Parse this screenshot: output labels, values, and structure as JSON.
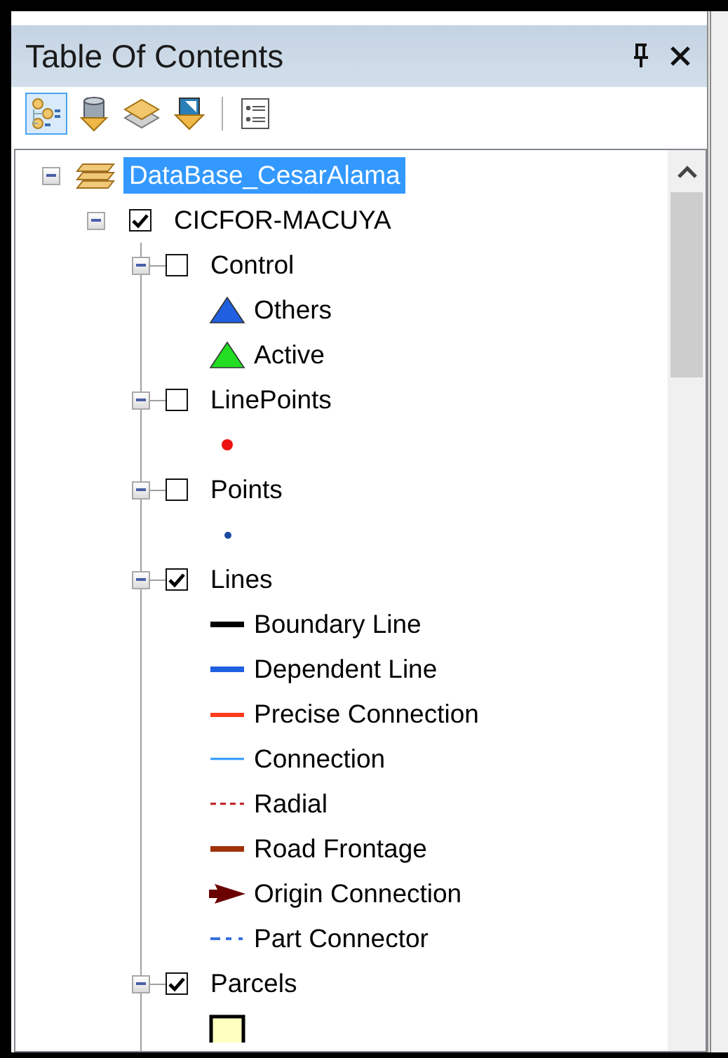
{
  "panel": {
    "title": "Table Of Contents"
  },
  "toolbar": [
    {
      "kind": "drawing-order",
      "selected": true
    },
    {
      "kind": "source",
      "selected": false
    },
    {
      "kind": "visibility",
      "selected": false
    },
    {
      "kind": "selection",
      "selected": false
    },
    {
      "kind": "options",
      "selected": false
    }
  ],
  "tree": {
    "label": "DataBase_CesarAlama",
    "selected": true,
    "expanded": true,
    "children": [
      {
        "label": "CICFOR-MACUYA",
        "checked": true,
        "expanded": true,
        "layers": [
          {
            "label": "Control",
            "checked": false,
            "expanded": true,
            "legend": [
              {
                "kind": "triangle",
                "color": "#1f5fe0",
                "label": "Others"
              },
              {
                "kind": "triangle",
                "color": "#22dd22",
                "label": "Active"
              }
            ]
          },
          {
            "label": "LinePoints",
            "checked": false,
            "expanded": true,
            "legend": [
              {
                "kind": "dot",
                "color": "#ee1111"
              }
            ]
          },
          {
            "label": "Points",
            "checked": false,
            "expanded": true,
            "legend": [
              {
                "kind": "small-dot",
                "color": "#1a4aa0"
              }
            ]
          },
          {
            "label": "Lines",
            "checked": true,
            "expanded": true,
            "legend": [
              {
                "kind": "thick-line",
                "color": "#000000",
                "label": "Boundary Line"
              },
              {
                "kind": "thick-line",
                "color": "#1f5fe0",
                "label": "Dependent Line"
              },
              {
                "kind": "line",
                "color": "#ff3b1f",
                "label": "Precise Connection"
              },
              {
                "kind": "thin-line",
                "color": "#3aa0ff",
                "label": "Connection"
              },
              {
                "kind": "dashed-line",
                "color": "#c0272d",
                "label": "Radial"
              },
              {
                "kind": "thick-line",
                "color": "#a0320a",
                "label": "Road Frontage"
              },
              {
                "kind": "arrow-line",
                "color": "#6b0000",
                "label": "Origin Connection"
              },
              {
                "kind": "dash-dot-line",
                "color": "#3a6fe0",
                "label": "Part Connector"
              }
            ]
          },
          {
            "label": "Parcels",
            "checked": true,
            "expanded": true,
            "legend": [
              {
                "kind": "fill",
                "color": "#ffffc0"
              }
            ]
          }
        ]
      }
    ]
  }
}
